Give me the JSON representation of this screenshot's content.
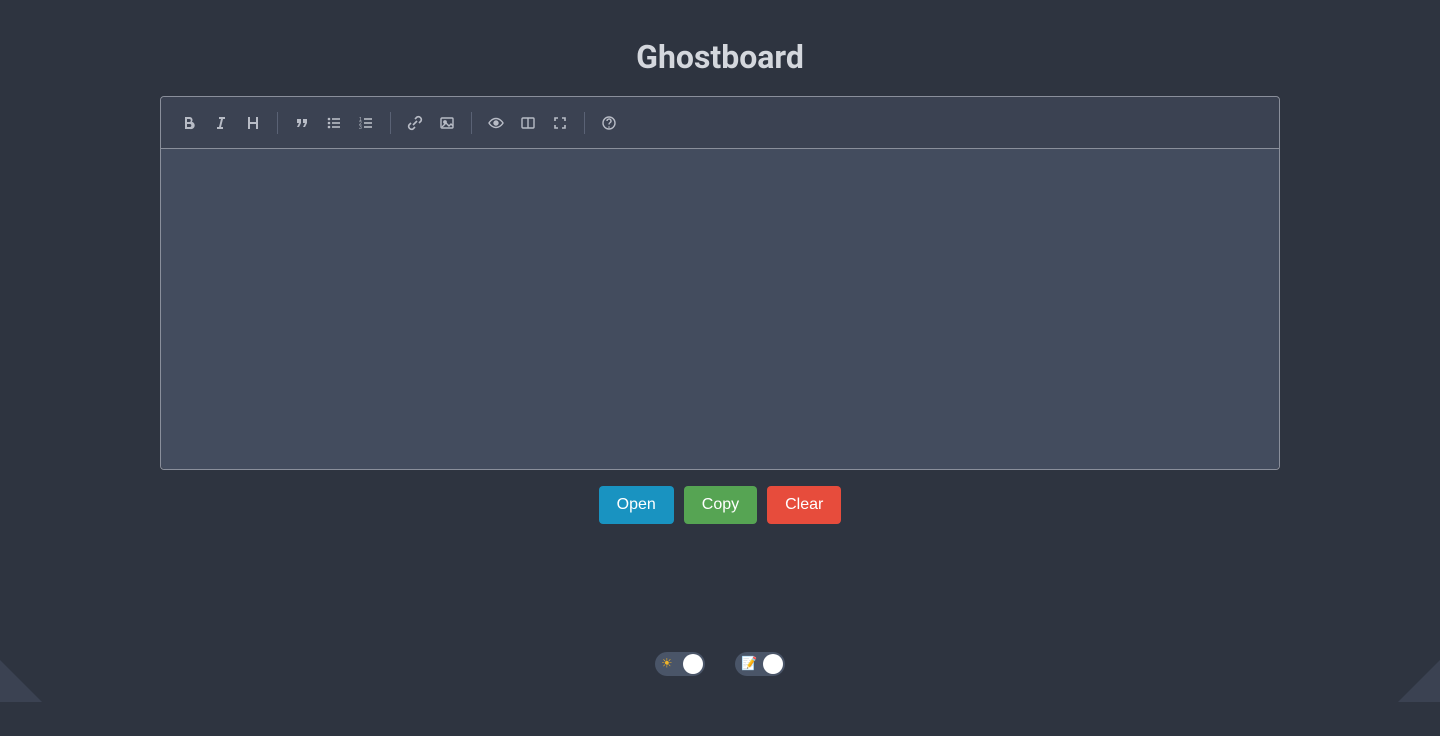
{
  "title": "Ghostboard",
  "toolbar": {
    "items": [
      "bold",
      "italic",
      "heading",
      "sep",
      "quote",
      "ul",
      "ol",
      "sep",
      "link",
      "image",
      "sep",
      "preview",
      "side-by-side",
      "fullscreen",
      "sep",
      "help"
    ]
  },
  "buttons": {
    "open": "Open",
    "copy": "Copy",
    "clear": "Clear"
  },
  "switches": {
    "theme_hint": "☀",
    "editor_hint": "📝",
    "theme_on": true,
    "editor_on": true
  },
  "colors": {
    "background": "#2e3440",
    "panel": "#3b4252",
    "blue": "#1993c1",
    "green": "#56a453",
    "red": "#e74c3c"
  }
}
